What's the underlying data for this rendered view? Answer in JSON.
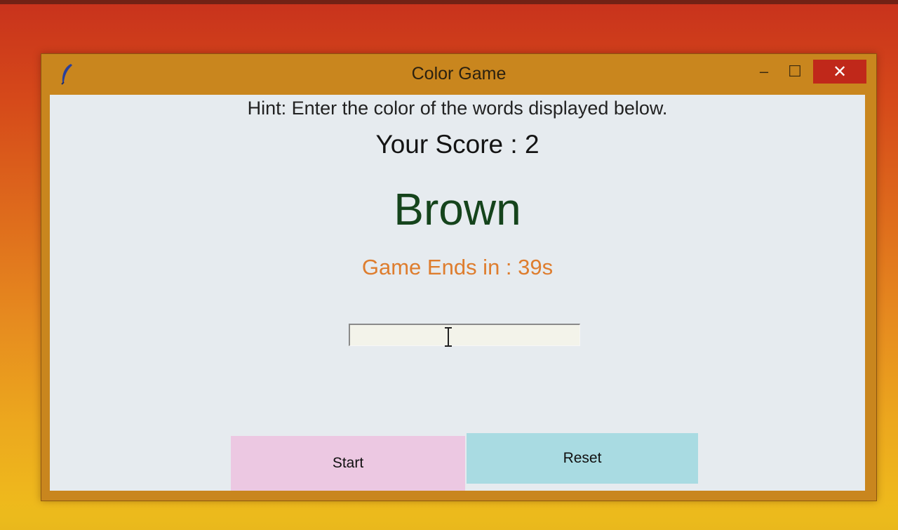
{
  "window": {
    "title": "Color Game",
    "controls": {
      "minimize_glyph": "–",
      "maximize_glyph": "☐",
      "close_glyph": "✕"
    },
    "app_icon": "feather-icon"
  },
  "game": {
    "hint": "Hint: Enter the color of the words displayed below.",
    "score_text": "Your Score : 2",
    "word": "Brown",
    "word_color": "#15441c",
    "timer_text": "Game Ends in : 39s",
    "timer_color": "#de7d2e",
    "entry_value": ""
  },
  "buttons": {
    "start_label": "Start",
    "start_color": "#ecc8e2",
    "reset_label": "Reset",
    "reset_color": "#a9dbe2"
  },
  "colors": {
    "title_bar": "#c9861e",
    "close_button": "#c0281a",
    "client_background": "#e6ebef"
  }
}
